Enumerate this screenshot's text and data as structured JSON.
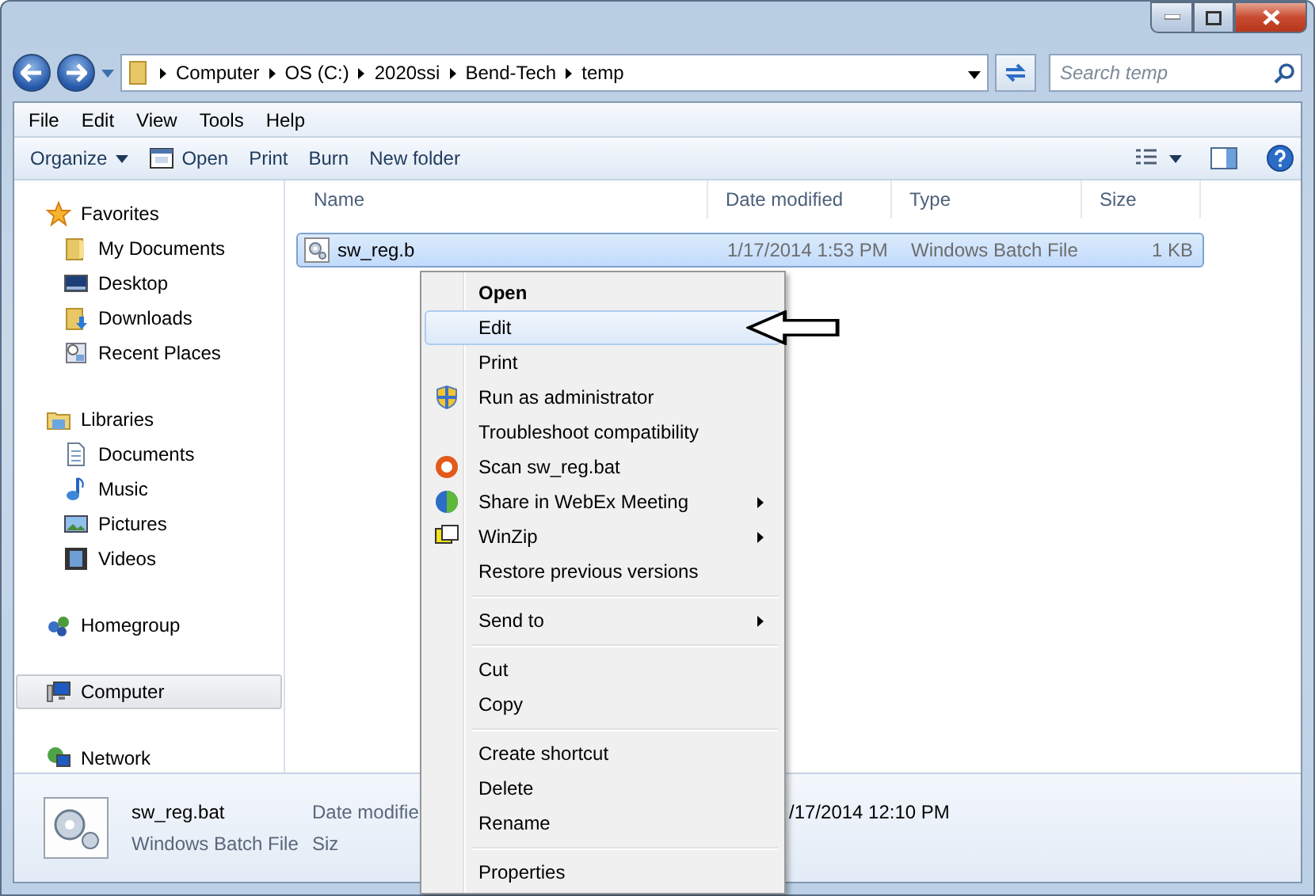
{
  "address_bar": {
    "crumbs": [
      "Computer",
      "OS (C:)",
      "2020ssi",
      "Bend-Tech",
      "temp"
    ]
  },
  "search": {
    "placeholder": "Search temp"
  },
  "menu_bar": [
    "File",
    "Edit",
    "View",
    "Tools",
    "Help"
  ],
  "command_bar": [
    {
      "label": "Organize",
      "kind": "dropdown"
    },
    {
      "label": "Open",
      "kind": "icon"
    },
    {
      "label": "Print",
      "kind": "plain"
    },
    {
      "label": "Burn",
      "kind": "plain"
    },
    {
      "label": "New folder",
      "kind": "plain"
    }
  ],
  "nav_pane": [
    {
      "label": "Favorites",
      "kind": "star",
      "selected": false,
      "children": [
        {
          "label": "My Documents",
          "kind": "folder",
          "selected": false
        },
        {
          "label": "Desktop",
          "kind": "desktop",
          "selected": false
        },
        {
          "label": "Downloads",
          "kind": "download",
          "selected": false
        },
        {
          "label": "Recent Places",
          "kind": "recent",
          "selected": false
        }
      ]
    },
    {
      "label": "Libraries",
      "kind": "library",
      "selected": false,
      "children": [
        {
          "label": "Documents",
          "kind": "document",
          "selected": false
        },
        {
          "label": "Music",
          "kind": "music",
          "selected": false
        },
        {
          "label": "Pictures",
          "kind": "pictures",
          "selected": false
        },
        {
          "label": "Videos",
          "kind": "videos",
          "selected": false
        }
      ]
    },
    {
      "label": "Homegroup",
      "kind": "homegroup",
      "selected": false
    },
    {
      "label": "Computer",
      "kind": "computer",
      "selected": true
    },
    {
      "label": "Network",
      "kind": "network",
      "selected": false
    }
  ],
  "file_list": {
    "columns": [
      "Name",
      "Date modified",
      "Type",
      "Size"
    ],
    "rows": [
      {
        "name": "sw_reg.b",
        "date": "1/17/2014 1:53 PM",
        "type": "Windows Batch File",
        "size": "1 KB",
        "selected": true
      }
    ]
  },
  "context_menu": [
    [
      {
        "label": "Open",
        "kind": "plain",
        "default": true,
        "submenu": false,
        "selected": false
      },
      {
        "label": "Edit",
        "kind": "plain",
        "default": false,
        "submenu": false,
        "selected": true
      },
      {
        "label": "Print",
        "kind": "plain",
        "default": false,
        "submenu": false,
        "selected": false
      },
      {
        "label": "Run as administrator",
        "kind": "shield",
        "default": false,
        "submenu": false,
        "selected": false
      },
      {
        "label": "Troubleshoot compatibility",
        "kind": "plain",
        "default": false,
        "submenu": false,
        "selected": false
      },
      {
        "label": "Scan sw_reg.bat",
        "kind": "scan",
        "default": false,
        "submenu": false,
        "selected": false
      },
      {
        "label": "Share in WebEx Meeting",
        "kind": "globe",
        "default": false,
        "submenu": true,
        "selected": false
      },
      {
        "label": "WinZip",
        "kind": "zip",
        "default": false,
        "submenu": true,
        "selected": false
      },
      {
        "label": "Restore previous versions",
        "kind": "plain",
        "default": false,
        "submenu": false,
        "selected": false
      }
    ],
    [
      {
        "label": "Send to",
        "kind": "plain",
        "default": false,
        "submenu": true,
        "selected": false
      }
    ],
    [
      {
        "label": "Cut",
        "kind": "plain",
        "default": false,
        "submenu": false,
        "selected": false
      },
      {
        "label": "Copy",
        "kind": "plain",
        "default": false,
        "submenu": false,
        "selected": false
      }
    ],
    [
      {
        "label": "Create shortcut",
        "kind": "plain",
        "default": false,
        "submenu": false,
        "selected": false
      },
      {
        "label": "Delete",
        "kind": "plain",
        "default": false,
        "submenu": false,
        "selected": false
      },
      {
        "label": "Rename",
        "kind": "plain",
        "default": false,
        "submenu": false,
        "selected": false
      }
    ],
    [
      {
        "label": "Properties",
        "kind": "plain",
        "default": false,
        "submenu": false,
        "selected": false
      }
    ]
  ],
  "details_pane": {
    "name": "sw_reg.bat",
    "type": "Windows Batch File",
    "fields": [
      {
        "label": "Date modifie",
        "value": "/17/2014 12:10 PM"
      },
      {
        "label": "Siz"
      }
    ]
  }
}
